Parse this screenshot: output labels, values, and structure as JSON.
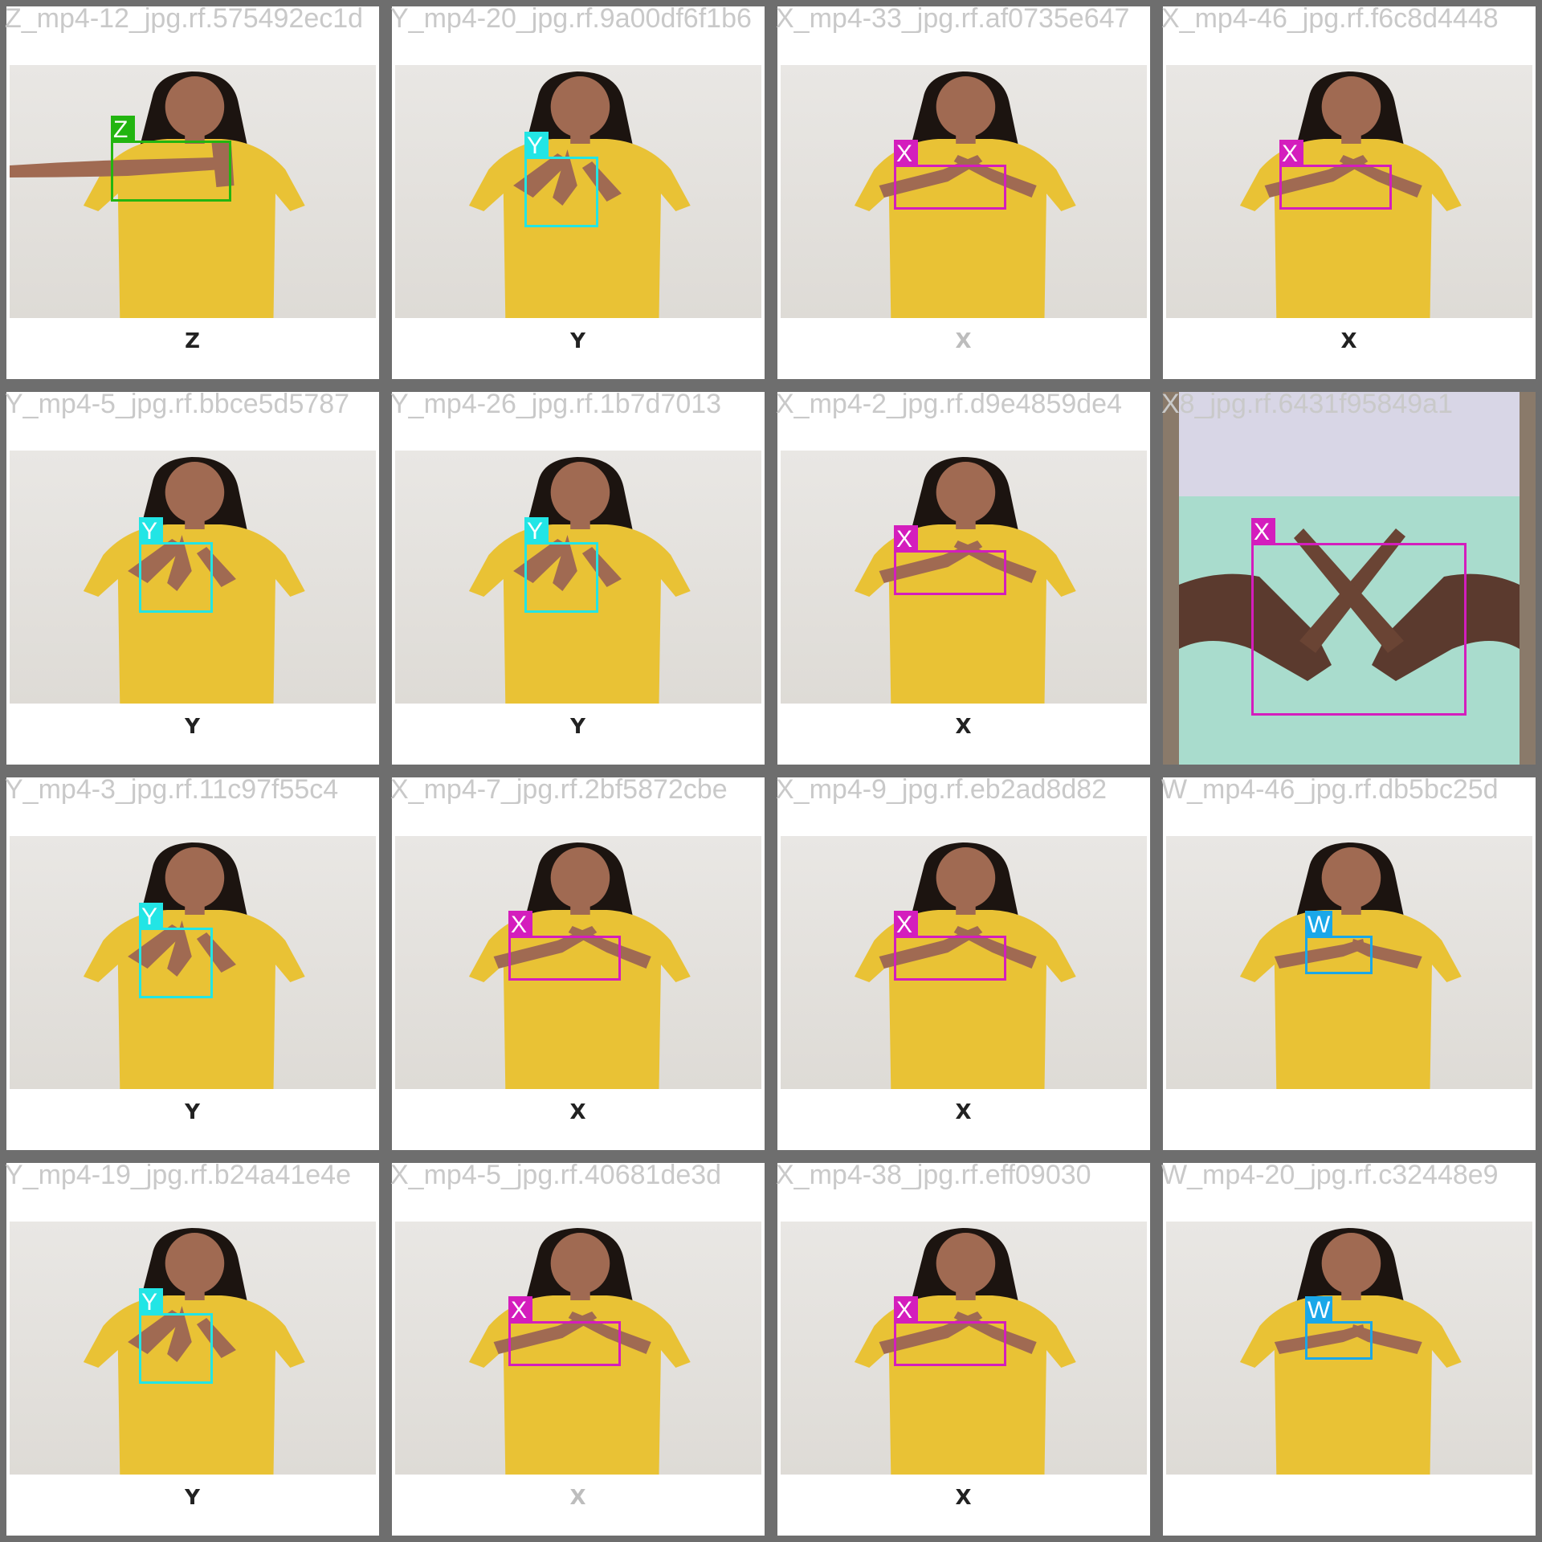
{
  "tiles": [
    {
      "filename": "Z_mp4-12_jpg.rf.575492ec1d",
      "caption": "Z",
      "label": "Z",
      "color": "#22b510",
      "variant": "standard",
      "pose": "z",
      "faded": false
    },
    {
      "filename": "Y_mp4-20_jpg.rf.9a00df6f1b6",
      "caption": "Y",
      "label": "Y",
      "color": "#22e5e5",
      "variant": "standard",
      "pose": "y",
      "faded": false
    },
    {
      "filename": "X_mp4-33_jpg.rf.af0735e647",
      "caption": "X",
      "label": "X",
      "color": "#d41dbd",
      "variant": "standard",
      "pose": "x",
      "faded": true
    },
    {
      "filename": "X_mp4-46_jpg.rf.f6c8d4448",
      "caption": "X",
      "label": "X",
      "color": "#d41dbd",
      "variant": "standard",
      "pose": "x",
      "faded": false
    },
    {
      "filename": "Y_mp4-5_jpg.rf.bbce5d5787",
      "caption": "Y",
      "label": "Y",
      "color": "#22e5e5",
      "variant": "standard",
      "pose": "y",
      "faded": false
    },
    {
      "filename": "Y_mp4-26_jpg.rf.1b7d7013",
      "caption": "Y",
      "label": "Y",
      "color": "#22e5e5",
      "variant": "standard",
      "pose": "y",
      "faded": false
    },
    {
      "filename": "X_mp4-2_jpg.rf.d9e4859de4",
      "caption": "X",
      "label": "X",
      "color": "#d41dbd",
      "variant": "standard",
      "pose": "x",
      "faded": false
    },
    {
      "filename": "X8_jpg.rf.6431f95849a1",
      "caption": "",
      "label": "X",
      "color": "#d41dbd",
      "variant": "closeup",
      "pose": "x",
      "faded": false
    },
    {
      "filename": "Y_mp4-3_jpg.rf.11c97f55c4",
      "caption": "Y",
      "label": "Y",
      "color": "#22e5e5",
      "variant": "standard",
      "pose": "y",
      "faded": false
    },
    {
      "filename": "X_mp4-7_jpg.rf.2bf5872cbe",
      "caption": "X",
      "label": "X",
      "color": "#d41dbd",
      "variant": "standard",
      "pose": "x",
      "faded": false
    },
    {
      "filename": "X_mp4-9_jpg.rf.eb2ad8d82",
      "caption": "X",
      "label": "X",
      "color": "#d41dbd",
      "variant": "standard",
      "pose": "x",
      "faded": false
    },
    {
      "filename": "W_mp4-46_jpg.rf.db5bc25d",
      "caption": "",
      "label": "W",
      "color": "#1aa7e8",
      "variant": "standard",
      "pose": "w",
      "faded": false
    },
    {
      "filename": "Y_mp4-19_jpg.rf.b24a41e4e",
      "caption": "Y",
      "label": "Y",
      "color": "#22e5e5",
      "variant": "standard",
      "pose": "y",
      "faded": false
    },
    {
      "filename": "X_mp4-5_jpg.rf.40681de3d",
      "caption": "X",
      "label": "X",
      "color": "#d41dbd",
      "variant": "standard",
      "pose": "x",
      "faded": true
    },
    {
      "filename": "X_mp4-38_jpg.rf.eff09030",
      "caption": "X",
      "label": "X",
      "color": "#d41dbd",
      "variant": "standard",
      "pose": "x",
      "faded": false
    },
    {
      "filename": "W_mp4-20_jpg.rf.c32448e9",
      "caption": "",
      "label": "W",
      "color": "#1aa7e8",
      "variant": "standard",
      "pose": "w",
      "faded": false
    }
  ]
}
